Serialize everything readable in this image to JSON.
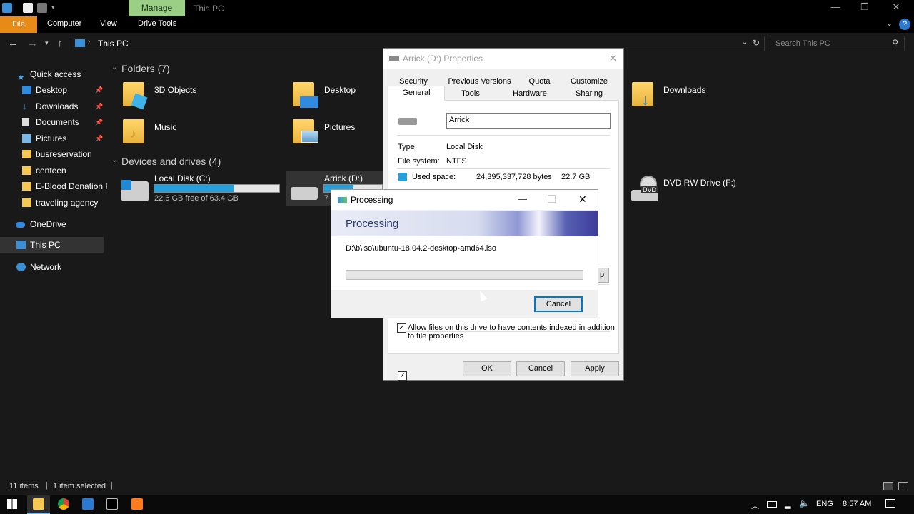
{
  "titlebar": {
    "manage_tab": "Manage",
    "title": "This PC"
  },
  "ribbon": {
    "file": "File",
    "computer": "Computer",
    "view": "View",
    "drive_tools": "Drive Tools"
  },
  "address": {
    "path": "This PC",
    "search_placeholder": "Search This PC"
  },
  "sidebar": {
    "quick_access": "Quick access",
    "items": [
      {
        "label": "Desktop",
        "pinned": true
      },
      {
        "label": "Downloads",
        "pinned": true
      },
      {
        "label": "Documents",
        "pinned": true
      },
      {
        "label": "Pictures",
        "pinned": true
      },
      {
        "label": "busreservation",
        "pinned": false
      },
      {
        "label": "centeen",
        "pinned": false
      },
      {
        "label": "E-Blood Donation F",
        "pinned": false
      },
      {
        "label": "traveling agency",
        "pinned": false
      }
    ],
    "onedrive": "OneDrive",
    "this_pc": "This PC",
    "network": "Network"
  },
  "main": {
    "folders_header": "Folders (7)",
    "folders": [
      "3D Objects",
      "Desktop",
      "Downloads",
      "Music",
      "Pictures"
    ],
    "devices_header": "Devices and drives (4)",
    "drives": [
      {
        "name": "Local Disk (C:)",
        "free": "22.6 GB free of 63.4 GB",
        "used_fraction": 0.64
      },
      {
        "name": "Arrick (D:)",
        "free": "7",
        "used_fraction": 0.5
      },
      {
        "name": "DVD RW Drive (F:)",
        "free": ""
      }
    ],
    "dvd_badge": "DVD"
  },
  "properties": {
    "title": "Arrick (D:) Properties",
    "tabs_row1": [
      "Security",
      "Previous Versions",
      "Quota",
      "Customize"
    ],
    "tabs_row2": [
      "General",
      "Tools",
      "Hardware",
      "Sharing"
    ],
    "name_value": "Arrick",
    "type_label": "Type:",
    "type_value": "Local Disk",
    "fs_label": "File system:",
    "fs_value": "NTFS",
    "used_label": "Used space:",
    "used_bytes": "24,395,337,728 bytes",
    "used_gb": "22.7 GB",
    "cleanup_fragment": "p",
    "index_checkbox": "Allow files on this drive to have contents indexed in addition to file properties",
    "ok": "OK",
    "cancel": "Cancel",
    "apply": "Apply"
  },
  "processing": {
    "title": "Processing",
    "heading": "Processing",
    "file": "D:\\b\\iso\\ubuntu-18.04.2-desktop-amd64.iso",
    "progress": 0,
    "cancel": "Cancel"
  },
  "status": {
    "items": "11 items",
    "selected": "1 item selected"
  },
  "taskbar": {
    "lang": "ENG",
    "time": "8:57 AM"
  },
  "colors": {
    "accent": "#26a0da",
    "manage": "#9bcf86",
    "file_tab": "#e88a17"
  }
}
